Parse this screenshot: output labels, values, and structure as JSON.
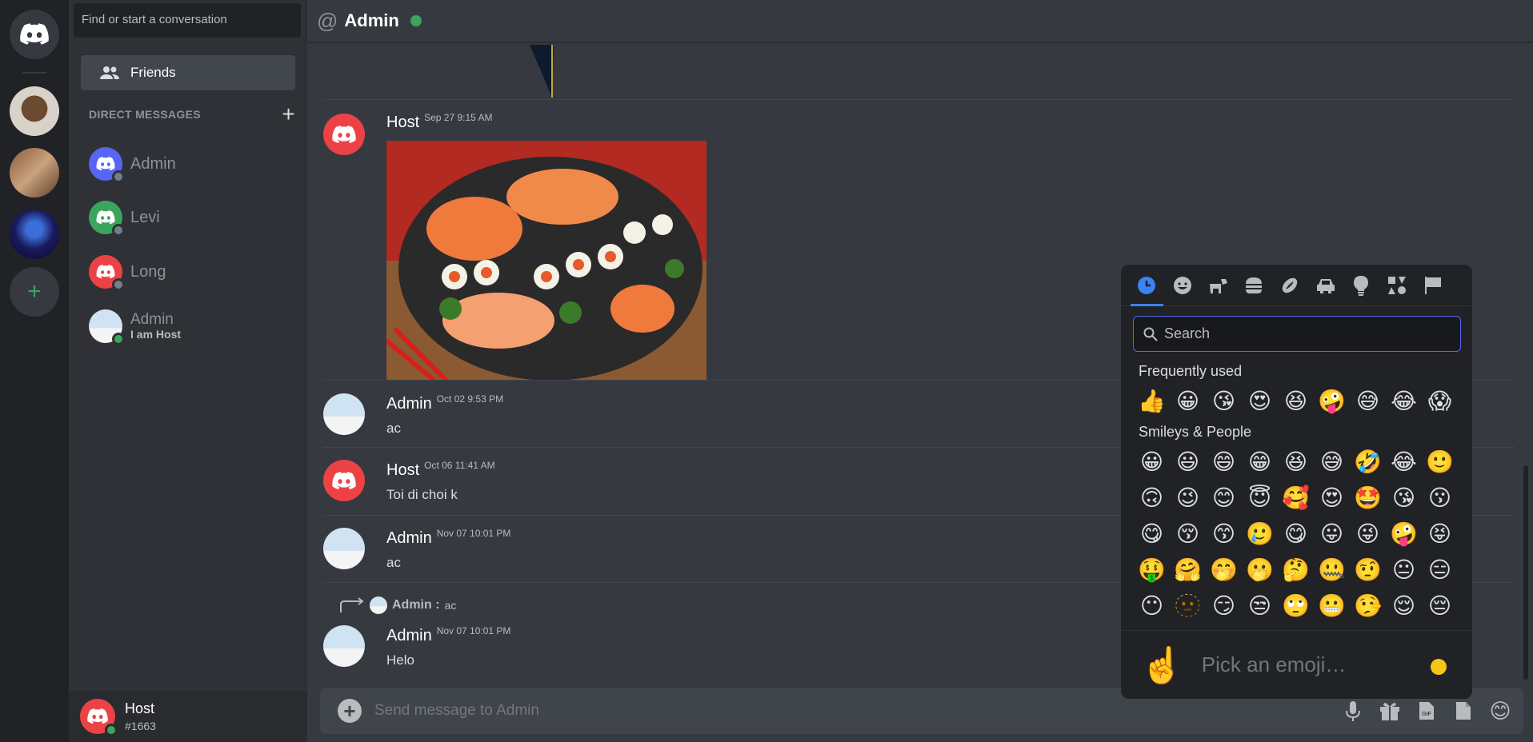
{
  "app": {
    "title": "Discord"
  },
  "sidebar": {
    "search_placeholder": "Find or start a conversation",
    "friends_label": "Friends",
    "dm_header": "DIRECT MESSAGES",
    "dms": [
      {
        "name": "Admin",
        "status": "offline",
        "avatar_color": "#5865f2"
      },
      {
        "name": "Levi",
        "status": "offline",
        "avatar_color": "#3ba55d"
      },
      {
        "name": "Long",
        "status": "offline",
        "avatar_color": "#ed4245"
      },
      {
        "name": "Admin",
        "subtitle": "I am Host",
        "status": "online"
      }
    ]
  },
  "user": {
    "name": "Host",
    "tag": "#1663"
  },
  "channel": {
    "title": "Admin",
    "status": "online"
  },
  "messages": [
    {
      "author": "Host",
      "time": "Sep 27 9:15 AM",
      "attachment": "sushi-photo"
    },
    {
      "author": "Admin",
      "time": "Oct 02 9:53 PM",
      "text": "ac"
    },
    {
      "author": "Host",
      "time": "Oct 06 11:41 AM",
      "text": "Toi di choi k"
    },
    {
      "author": "Admin",
      "time": "Nov 07 10:01 PM",
      "text": "ac"
    },
    {
      "author": "Admin",
      "time": "Nov 07 10:01 PM",
      "text": "Helo",
      "reply_to": {
        "author": "Admin :",
        "text": "ac"
      }
    }
  ],
  "composer": {
    "placeholder": "Send message to Admin"
  },
  "emoji_picker": {
    "categories": [
      "recent-icon",
      "smiley-icon",
      "animal-icon",
      "food-icon",
      "activity-icon",
      "travel-icon",
      "objects-icon",
      "symbols-icon",
      "flags-icon"
    ],
    "active_category": "recent-icon",
    "search_placeholder": "Search",
    "sections": [
      {
        "title": "Frequently used",
        "emojis": [
          "👍",
          "😀",
          "😘",
          "😍",
          "😆",
          "🤪",
          "😅",
          "😂",
          "😱"
        ]
      },
      {
        "title": "Smileys & People",
        "emojis": [
          "😀",
          "😃",
          "😄",
          "😁",
          "😆",
          "😅",
          "🤣",
          "😂",
          "🙂",
          "🙃",
          "😉",
          "😊",
          "😇",
          "🥰",
          "😍",
          "🤩",
          "😘",
          "😗",
          "😋",
          "😚",
          "😙",
          "🥲",
          "😋",
          "😛",
          "😜",
          "🤪",
          "😝",
          "🤑",
          "🤗",
          "🤭",
          "🫢",
          "🤔",
          "🤐",
          "🤨",
          "😐",
          "😑",
          "😶",
          "🫥",
          "😏",
          "😒",
          "🙄",
          "😬",
          "🤥",
          "😌",
          "😔"
        ]
      }
    ],
    "preview": {
      "emoji": "☝️",
      "label": "Pick an emoji…"
    }
  },
  "colors": {
    "accent": "#5865f2",
    "online": "#3ba55d",
    "brand_red": "#ed4245",
    "picker_active": "#3b82f6"
  }
}
